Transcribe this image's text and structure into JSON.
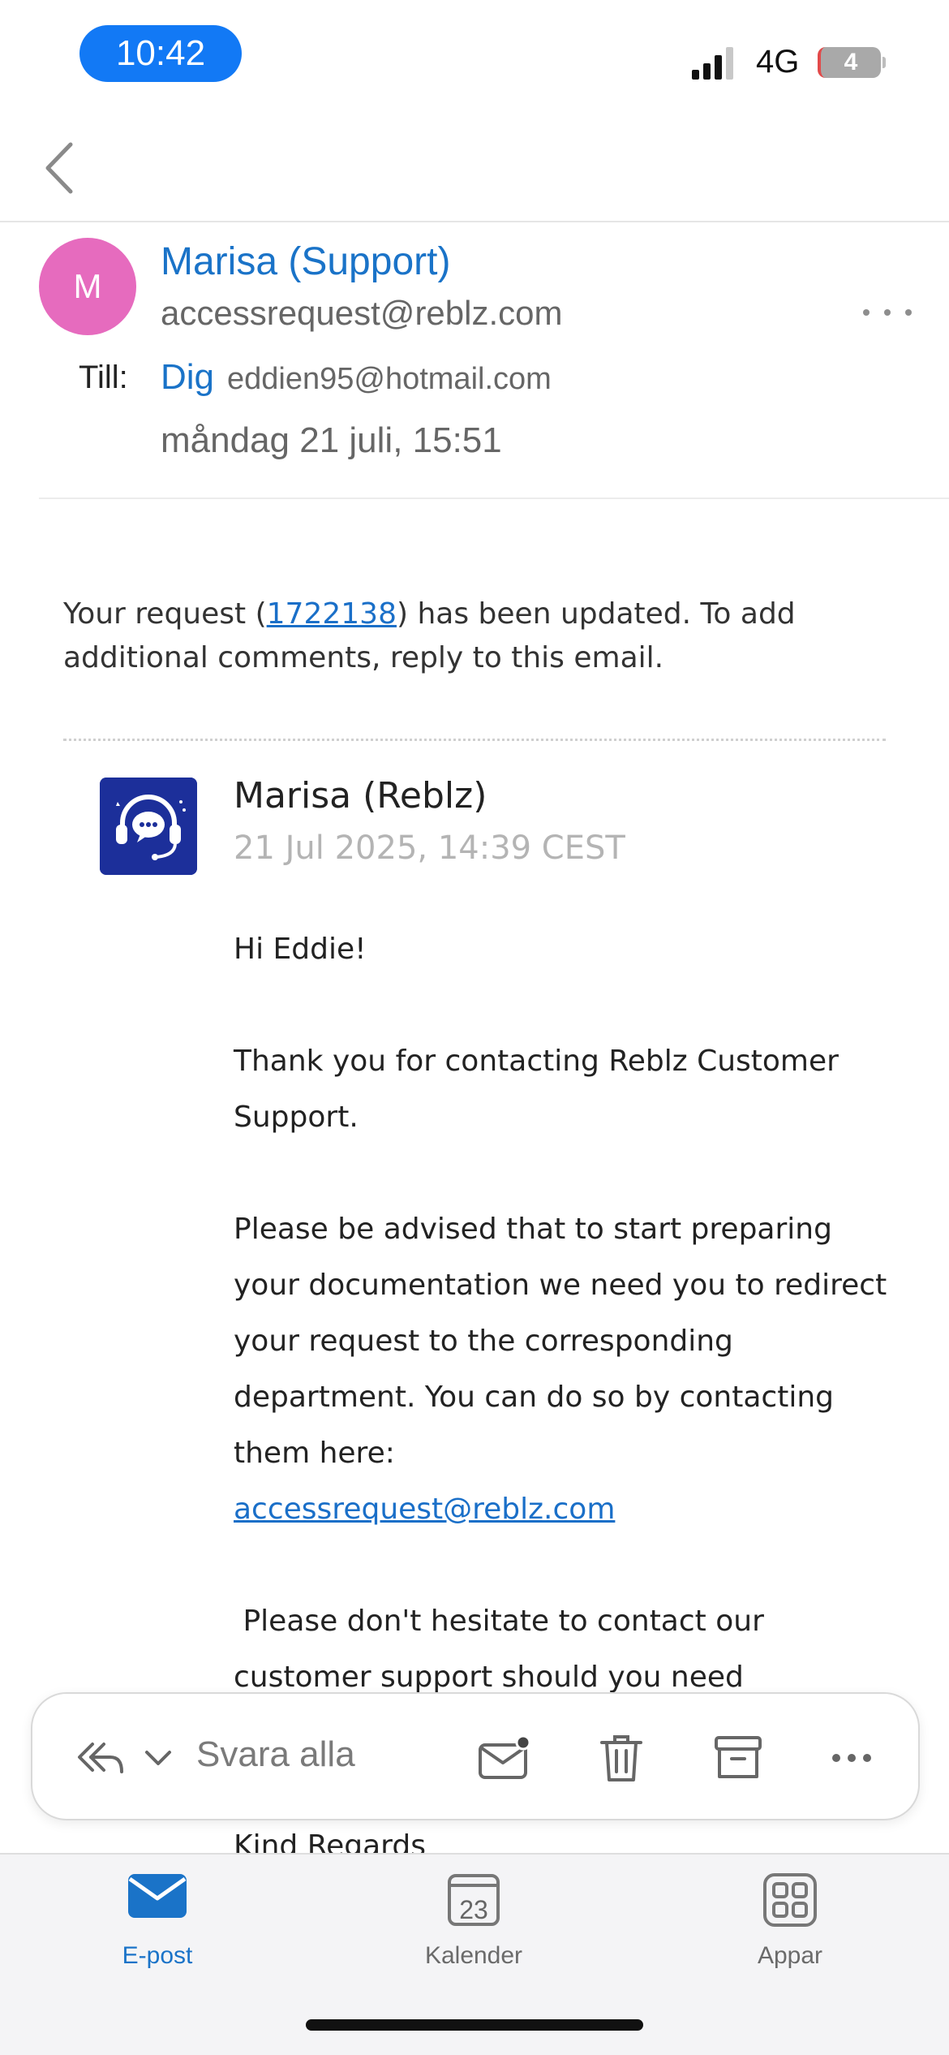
{
  "status_bar": {
    "time": "10:42",
    "network": "4G",
    "battery": "4"
  },
  "email": {
    "sender_initial": "M",
    "sender_name": "Marisa (Support)",
    "sender_email": "accessrequest@reblz.com",
    "to_label": "Till:",
    "to_name": "Dig",
    "to_email": "eddien95@hotmail.com",
    "date": "måndag 21 juli, 15:51",
    "intro_before": "Your request (",
    "intro_link": "1722138",
    "intro_after": ") has been updated. To add additional comments, reply to this email.",
    "agent_name": "Marisa",
    "agent_org": " (Reblz)",
    "agent_date": "21 Jul 2025, 14:39 CEST",
    "greeting": "Hi Eddie!",
    "paragraph_1": "Thank you for contacting Reblz Customer Support.",
    "paragraph_2": "Please be advised that to start preparing your documentation we need you to redirect your request to the corresponding department. You can do so by contacting them here:",
    "paragraph_2_link": "accessrequest@reblz.com",
    "paragraph_3": " Please don't hesitate to contact our customer support should you need",
    "signoff": "Kind Regards"
  },
  "action_bar": {
    "reply_all_label": "Svara alla",
    "icons": [
      "reply-all-icon",
      "chevron-down-icon",
      "mark-unread-icon",
      "trash-icon",
      "archive-icon",
      "more-icon"
    ]
  },
  "tabs": [
    {
      "label": "E-post",
      "icon": "mail-icon",
      "active": true
    },
    {
      "label": "Kalender",
      "icon": "calendar-icon",
      "calendar_day": "23",
      "active": false
    },
    {
      "label": "Appar",
      "icon": "apps-grid-icon",
      "active": false
    }
  ],
  "colors": {
    "accent": "#1a73c8",
    "avatar": "#e66bbe",
    "time_pill": "#1279f5",
    "agent_logo": "#1c2f9a"
  }
}
